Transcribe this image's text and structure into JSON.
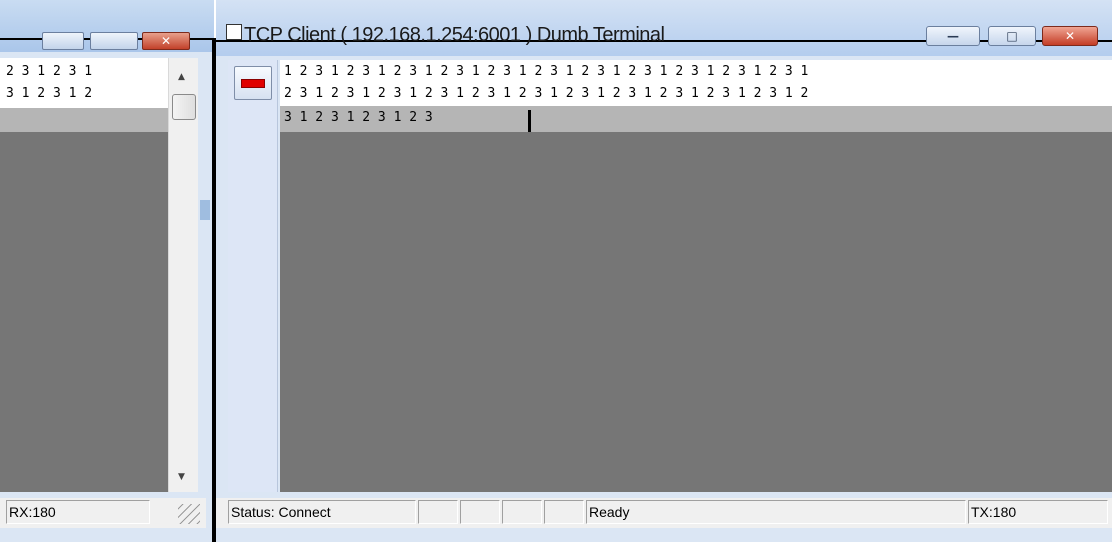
{
  "back_window": {
    "buttons": {
      "close_glyph": "✕"
    },
    "terminal_lines": [
      "2 3 1 2 3 1",
      "3 1 2 3 1 2"
    ],
    "scroll_up_glyph": "▲",
    "scroll_down_glyph": "▼",
    "status": {
      "rx": "RX:180"
    }
  },
  "front_window": {
    "title": "TCP Client ( 192.168.1.254:6001 ) Dumb Terminal",
    "buttons": {
      "minimize_glyph": "—",
      "maximize_glyph": "□",
      "close_glyph": "✕"
    },
    "terminal_lines": [
      "1 2 3 1 2 3 1 2 3 1 2 3 1 2 3 1 2 3 1 2 3 1 2 3 1 2 3 1 2 3 1 2 3 1",
      "2 3 1 2 3 1 2 3 1 2 3 1 2 3 1 2 3 1 2 3 1 2 3 1 2 3 1 2 3 1 2 3 1 2",
      "3 1 2 3 1 2 3 1 2 3"
    ],
    "status": {
      "connection": "Status: Connect",
      "state": "Ready",
      "tx": "TX:180"
    }
  },
  "icons": {
    "record_stop": "record-stop-icon",
    "app_icon": "terminal-app-icon",
    "resize_grip": "resize-grip-icon"
  },
  "colors": {
    "terminal_bg": "#767676",
    "highlight_line": "#b5b5b5",
    "close_red": "#c43d26",
    "record_red": "#e00000"
  }
}
